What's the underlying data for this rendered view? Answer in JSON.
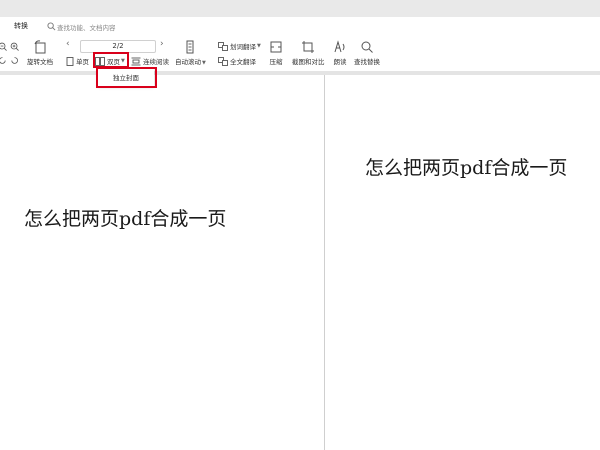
{
  "tabbar": {
    "tab": "转换",
    "search_placeholder": "查找功能、文档内容"
  },
  "toolbar": {
    "rotate_doc": "旋转文档",
    "single_page": "单页",
    "double_page": "双页",
    "continuous_read": "连续阅读",
    "auto_scroll": "自动滚动",
    "word_translate": "划词翻译",
    "full_translate": "全文翻译",
    "compress": "压缩",
    "screenshot_compare": "截图和对比",
    "read_aloud": "朗读",
    "find_replace": "查找替换",
    "page_indicator": "2/2"
  },
  "dropdown": {
    "item": "独立封面"
  },
  "document": {
    "left_page_text": "怎么把两页pdf合成一页",
    "right_page_text": "怎么把两页pdf合成一页"
  },
  "colors": {
    "highlight": "#d9001b",
    "toolbar_bg": "#ffffff",
    "top_strip": "#e9e9e9"
  }
}
